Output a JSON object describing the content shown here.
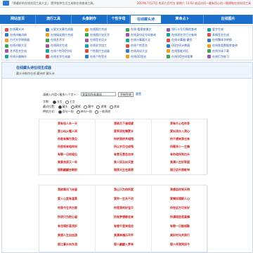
{
  "topbar": {
    "left_text": "「换最好的在线实用工具大全」 提供各种生活工具和在线查询工具。",
    "right_text": "2019年7月27日 农历六月廿五 星期六 13:02 欢迎访问—最有用心机—随便啦在线实用工具"
  },
  "nav": {
    "items": [
      "网站首页",
      "流行工具",
      "头像制作",
      "个性字母",
      "在线藏头诗",
      "算命占卜",
      "在线图片"
    ],
    "active_index": 4
  },
  "tools": [
    [
      "在线藏头诗",
      "火星文文章生成器",
      "在线图片合成",
      "在线-看星座美文",
      "银行卡号归属地查询",
      "爱字生成"
    ],
    [
      "在线诗集词典",
      "在线搞笑图片合成",
      "在线图片加文字",
      "在线身份证号码查询",
      "在线测名字打分查询",
      "表情签名生成"
    ],
    [
      "古代文字转换器",
      "在线艺术字",
      "在线签名设计",
      "在线计算器大全",
      "在线计算器-最优",
      "在线繁体字转换"
    ],
    [
      "在线对联大全",
      "在线网名生成",
      "在线文字加工",
      "在线个性签名",
      "QQ空间计数器",
      "在线各类数据库查询"
    ],
    [
      "艺术签名生成",
      "在线个性QQ空间",
      "个性图片生成器",
      "在线测试大全",
      "在线智能对话",
      "在线字体下载"
    ],
    [
      "在线头像制作",
      "在线名字生成器",
      "在线个性签名",
      "在线QQ签名",
      "在线QQ空间背景",
      "在线打字练习"
    ]
  ],
  "section": {
    "title": "在线藏头诗在线生成器",
    "subtitle": "藏头诗制作在线 藏诗库 藏头诗"
  },
  "form": {
    "prompt": "请输入内容<最多八个字>:",
    "input_value": "我爱你所有美丽",
    "submit_label": "开始生成",
    "reset_label": "重置",
    "row1_label": "字数:",
    "row1_options": [
      "五言",
      "七言"
    ],
    "row2_label": "藏词位置:",
    "row2_options": [
      "藏头",
      "藏尾",
      "藏中",
      "递增",
      "递减"
    ],
    "row3_label": "押韵方式:",
    "row3_options": [
      "双句一韵",
      "单句一韵",
      "一韵到底"
    ]
  },
  "poems": [
    {
      "col1": [
        "我有佳人永一天",
        "爱心似火暖人间",
        "你若有情为我见",
        "所思将来相伴间",
        "有朝一日终相见",
        "美景良辰又一年",
        "丽影翩翩在眼前"
      ],
      "col2": [
        "我欲月下遥相望",
        "爱到深处情更长",
        "你侬我侬共相惜",
        "所以岁月也成殇",
        "有意无意恋吉祥",
        "美人如玉似天堂",
        "丽质天生在两旁"
      ],
      "col3": [
        "我有片心在你身",
        "爱似流水入我心",
        "你不想来我也来",
        "所需多少一生情",
        "有你相伴到白头",
        "美满人生好家庭",
        "丽日初升照乾坤"
      ]
    },
    {
      "col1": [
        "我欲乘风飞去留",
        "爱人心里有温柔",
        "你我今生共白首",
        "所求只为把心留",
        "有花堪折直须折",
        "美丽人生自由游",
        "丽江春水向东流"
      ],
      "col2": [
        "我心只为你所爱",
        "爱你一生永不改",
        "你是我的好宝贝",
        "所有梦想都会来",
        "有缘千里来相会",
        "美满幸福乐开怀",
        "丽人翩翩入梦来"
      ],
      "col3": [
        "我想念你到天明",
        "爱情如酒醉人心",
        "你在远方可安好",
        "所谓相思是真情",
        "有朝一日能相聚",
        "美好时光共同行",
        "丽人伴我到如今"
      ]
    }
  ]
}
